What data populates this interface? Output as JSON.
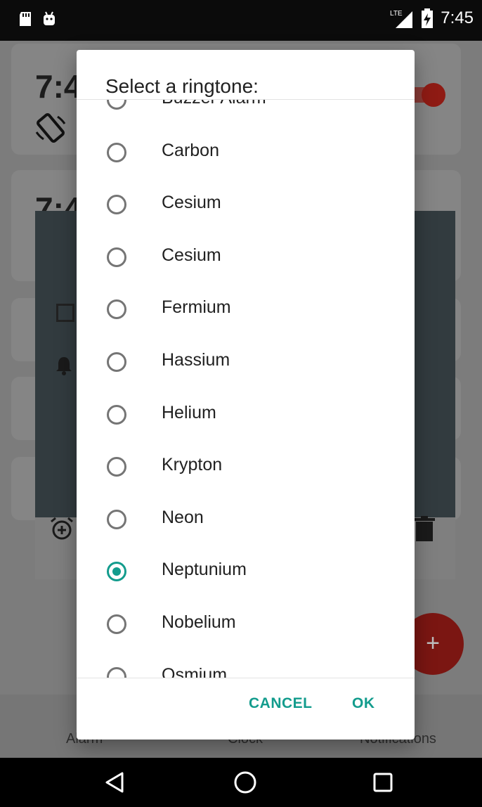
{
  "status_bar": {
    "time": "7:45",
    "network": "LTE"
  },
  "background": {
    "card_time_1": "7:4",
    "card_time_2": "7:4",
    "nav": {
      "alarm": "Alarm",
      "clock": "Clock",
      "notifications": "Notifications"
    },
    "fab_label": "+"
  },
  "dialog": {
    "title": "Select a ringtone:",
    "items": [
      {
        "label": "Buzzer Alarm",
        "checked": false
      },
      {
        "label": "Carbon",
        "checked": false
      },
      {
        "label": "Cesium",
        "checked": false
      },
      {
        "label": "Cesium",
        "checked": false
      },
      {
        "label": "Fermium",
        "checked": false
      },
      {
        "label": "Hassium",
        "checked": false
      },
      {
        "label": "Helium",
        "checked": false
      },
      {
        "label": "Krypton",
        "checked": false
      },
      {
        "label": "Neon",
        "checked": false
      },
      {
        "label": "Neptunium",
        "checked": true
      },
      {
        "label": "Nobelium",
        "checked": false
      },
      {
        "label": "Osmium",
        "checked": false
      }
    ],
    "cancel_label": "CANCEL",
    "ok_label": "OK",
    "accent_color": "#139c8d"
  }
}
